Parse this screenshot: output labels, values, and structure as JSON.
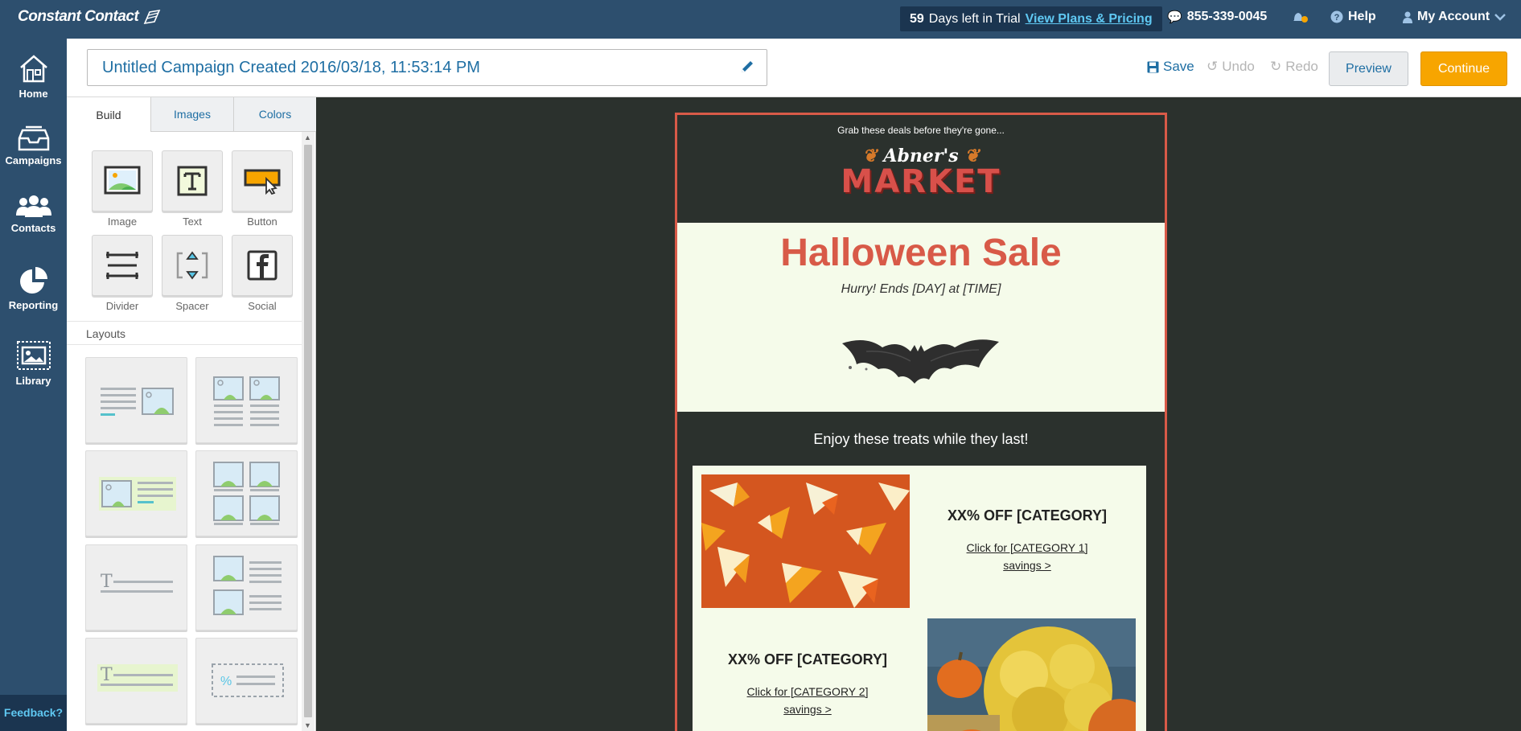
{
  "topbar": {
    "logo_text": "Constant Contact",
    "trial_days": "59",
    "trial_text": "Days left in Trial",
    "trial_link": "View Plans & Pricing",
    "phone": "855-339-0045",
    "help": "Help",
    "account": "My Account"
  },
  "leftnav": {
    "items": [
      {
        "label": "Home",
        "icon": "home-icon"
      },
      {
        "label": "Campaigns",
        "icon": "campaigns-icon"
      },
      {
        "label": "Contacts",
        "icon": "contacts-icon"
      },
      {
        "label": "Reporting",
        "icon": "reporting-icon"
      },
      {
        "label": "Library",
        "icon": "library-icon"
      }
    ],
    "feedback": "Feedback?"
  },
  "header": {
    "campaign_title": "Untitled Campaign Created 2016/03/18, 11:53:14 PM",
    "save": "Save",
    "undo": "Undo",
    "redo": "Redo",
    "preview": "Preview",
    "continue": "Continue"
  },
  "panel": {
    "tabs": [
      "Build",
      "Images",
      "Colors"
    ],
    "active_tab": "Build",
    "tools": [
      {
        "label": "Image",
        "icon": "image-icon"
      },
      {
        "label": "Text",
        "icon": "text-icon"
      },
      {
        "label": "Button",
        "icon": "button-icon"
      },
      {
        "label": "Divider",
        "icon": "divider-icon"
      },
      {
        "label": "Spacer",
        "icon": "spacer-icon"
      },
      {
        "label": "Social",
        "icon": "facebook-icon"
      }
    ],
    "layouts_title": "Layouts"
  },
  "email": {
    "preheader": "Grab these deals before they're gone...",
    "brand_script": "Abner's",
    "brand_name": "MARKET",
    "hero_title": "Halloween Sale",
    "hero_subtitle": "Hurry! Ends [DAY] at [TIME]",
    "section_heading": "Enjoy these treats while they last!",
    "offers": [
      {
        "heading": "XX% OFF [CATEGORY]",
        "link_line1": "Click for [CATEGORY 1]",
        "link_line2": "savings >"
      },
      {
        "heading": "XX% OFF [CATEGORY]",
        "link_line1": "Click for [CATEGORY 2]",
        "link_line2": "savings >"
      }
    ]
  },
  "colors": {
    "nav_bg": "#2d4f6e",
    "accent_blue": "#1e6ea3",
    "continue_orange": "#f7a500",
    "email_border": "#d85a48",
    "canvas_bg": "#2b312d"
  }
}
